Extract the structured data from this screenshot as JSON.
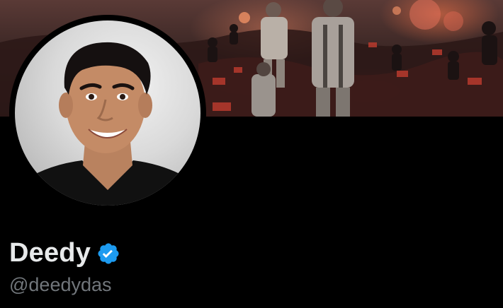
{
  "profile": {
    "display_name": "Deedy",
    "handle": "@deedydas",
    "verified_badge_icon": "verified-badge-icon",
    "verified_color": "#1d9bf0"
  },
  "colors": {
    "background": "#000000",
    "name_text": "#e7e9ea",
    "handle_text": "#71767b"
  }
}
